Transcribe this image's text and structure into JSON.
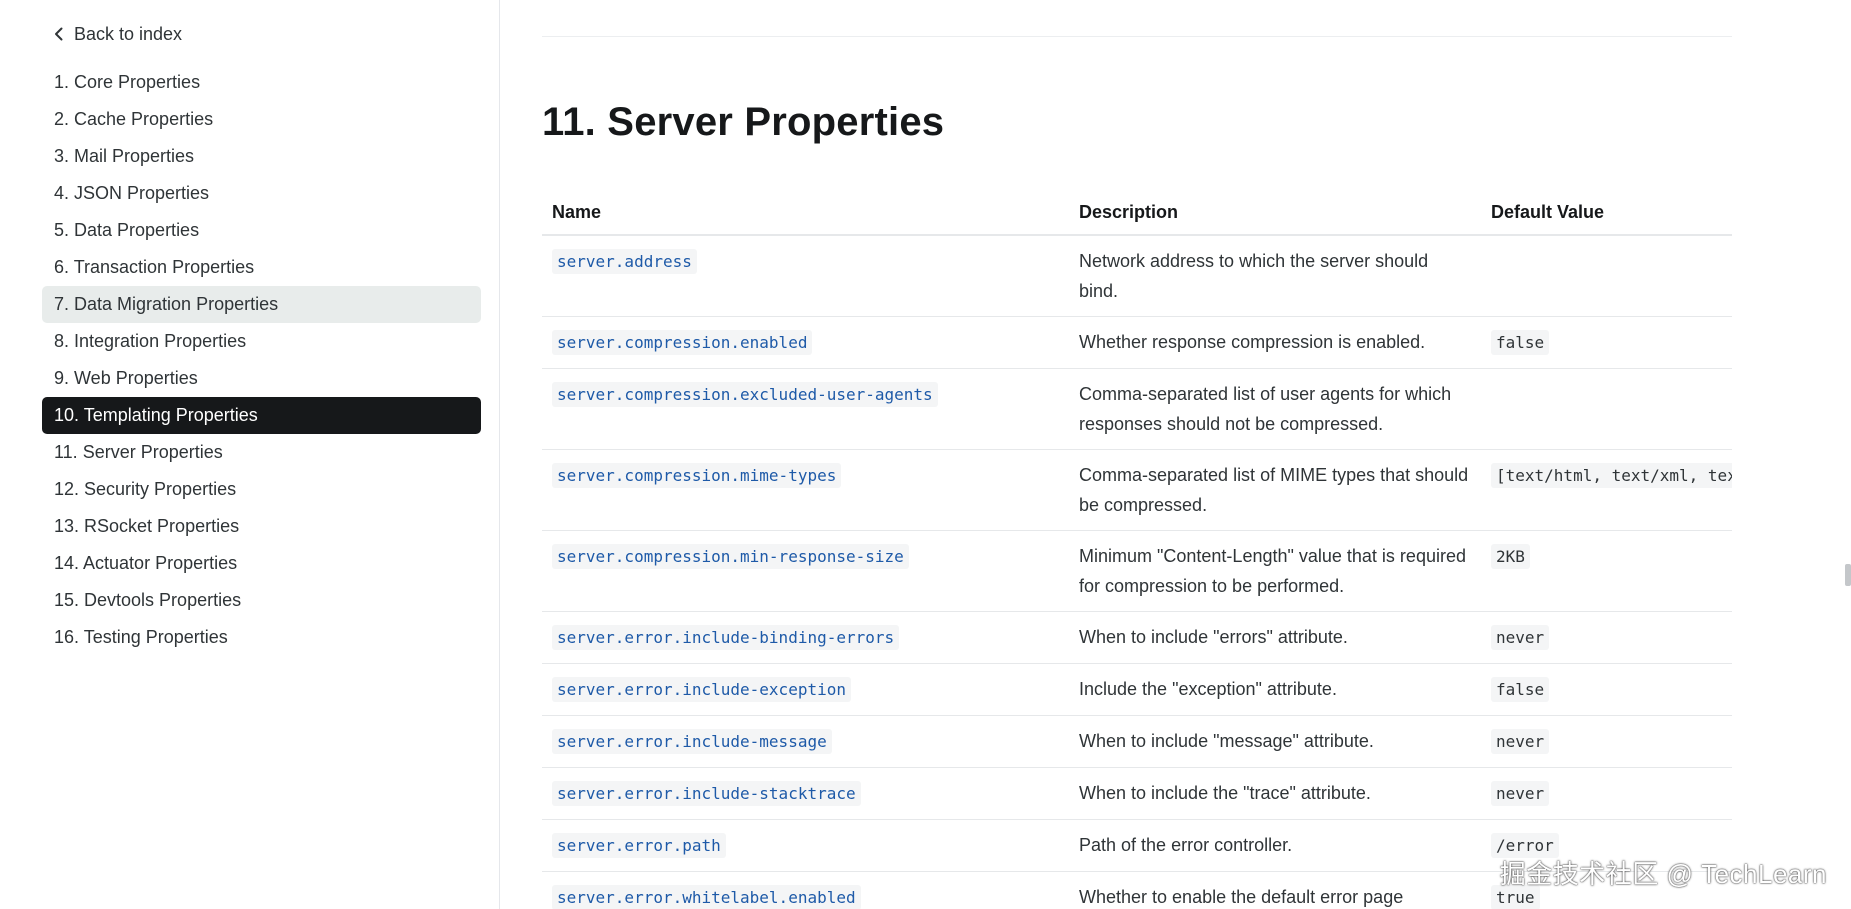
{
  "sidebar": {
    "back_label": "Back to index",
    "items": [
      {
        "label": "1. Core Properties",
        "state": "normal"
      },
      {
        "label": "2. Cache Properties",
        "state": "normal"
      },
      {
        "label": "3. Mail Properties",
        "state": "normal"
      },
      {
        "label": "4. JSON Properties",
        "state": "normal"
      },
      {
        "label": "5. Data Properties",
        "state": "normal"
      },
      {
        "label": "6. Transaction Properties",
        "state": "normal"
      },
      {
        "label": "7. Data Migration Properties",
        "state": "hover"
      },
      {
        "label": "8. Integration Properties",
        "state": "normal"
      },
      {
        "label": "9. Web Properties",
        "state": "normal"
      },
      {
        "label": "10. Templating Properties",
        "state": "active"
      },
      {
        "label": "11. Server Properties",
        "state": "normal"
      },
      {
        "label": "12. Security Properties",
        "state": "normal"
      },
      {
        "label": "13. RSocket Properties",
        "state": "normal"
      },
      {
        "label": "14. Actuator Properties",
        "state": "normal"
      },
      {
        "label": "15. Devtools Properties",
        "state": "normal"
      },
      {
        "label": "16. Testing Properties",
        "state": "normal"
      }
    ]
  },
  "main": {
    "section_title": "11. Server Properties",
    "table": {
      "headers": [
        "Name",
        "Description",
        "Default Value"
      ],
      "rows": [
        {
          "name": "server.address",
          "description": "Network address to which the server should bind.",
          "default": ""
        },
        {
          "name": "server.compression.enabled",
          "description": "Whether response compression is enabled.",
          "default": "false"
        },
        {
          "name": "server.compression.excluded-user-agents",
          "description": "Comma-separated list of user agents for which responses should not be compressed.",
          "default": ""
        },
        {
          "name": "server.compression.mime-types",
          "description": "Comma-separated list of MIME types that should be compressed.",
          "default": "[text/html, text/xml, text/"
        },
        {
          "name": "server.compression.min-response-size",
          "description": "Minimum \"Content-Length\" value that is required for compression to be performed.",
          "default": "2KB"
        },
        {
          "name": "server.error.include-binding-errors",
          "description": "When to include \"errors\" attribute.",
          "default": "never"
        },
        {
          "name": "server.error.include-exception",
          "description": "Include the \"exception\" attribute.",
          "default": "false"
        },
        {
          "name": "server.error.include-message",
          "description": "When to include \"message\" attribute.",
          "default": "never"
        },
        {
          "name": "server.error.include-stacktrace",
          "description": "When to include the \"trace\" attribute.",
          "default": "never"
        },
        {
          "name": "server.error.path",
          "description": "Path of the error controller.",
          "default": "/error"
        },
        {
          "name": "server.error.whitelabel.enabled",
          "description": "Whether to enable the default error page",
          "default": "true"
        }
      ]
    }
  },
  "watermark": "掘金技术社区 @ TechLearn",
  "colors": {
    "active_bg": "#16181a",
    "hover_bg": "#e8eceb",
    "code_link": "#1e5aa8",
    "code_bg": "#f4f5f6"
  },
  "icons": {
    "back": "chevron-left-icon"
  }
}
